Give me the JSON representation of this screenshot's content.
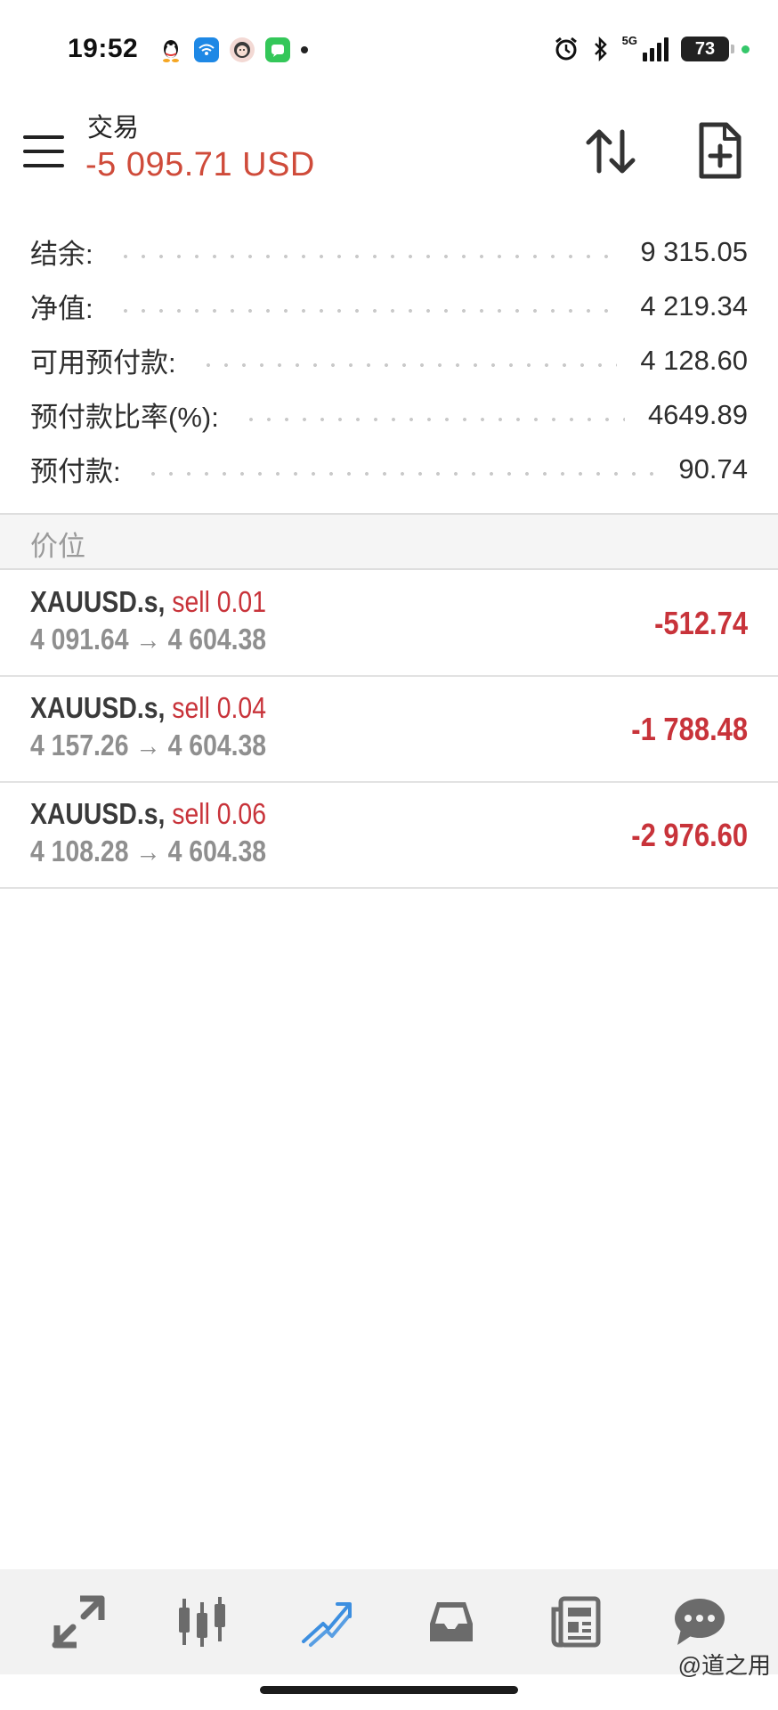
{
  "status_bar": {
    "time": "19:52",
    "network": "5G",
    "battery": "73"
  },
  "toolbar": {
    "title": "交易",
    "balance": "-5 095.71 USD"
  },
  "summary": [
    {
      "label": "结余:",
      "value": "9 315.05"
    },
    {
      "label": "净值:",
      "value": "4 219.34"
    },
    {
      "label": "可用预付款:",
      "value": "4 128.60"
    },
    {
      "label": "预付款比率(%):",
      "value": "4649.89"
    },
    {
      "label": "预付款:",
      "value": "90.74"
    }
  ],
  "positions_header": "价位",
  "positions": [
    {
      "symbol": "XAUUSD.s,",
      "side": "sell 0.01",
      "prices": "4 091.64 → 4 604.38",
      "profit": "-512.74"
    },
    {
      "symbol": "XAUUSD.s,",
      "side": "sell 0.04",
      "prices": "4 157.26 → 4 604.38",
      "profit": "-1 788.48"
    },
    {
      "symbol": "XAUUSD.s,",
      "side": "sell 0.06",
      "prices": "4 108.28 → 4 604.38",
      "profit": "-2 976.60"
    }
  ],
  "bottom_nav": [
    {
      "icon": "quotes-icon",
      "active": false
    },
    {
      "icon": "chart-icon",
      "active": false
    },
    {
      "icon": "trade-icon",
      "active": true
    },
    {
      "icon": "history-icon",
      "active": false
    },
    {
      "icon": "news-icon",
      "active": false
    },
    {
      "icon": "messages-icon",
      "active": false
    }
  ],
  "watermark": "@道之用",
  "colors": {
    "negative": "#c8333a",
    "balance": "#cf4b3a",
    "active_nav": "#3d8fe0",
    "nav_icon": "#6b6b6b"
  }
}
